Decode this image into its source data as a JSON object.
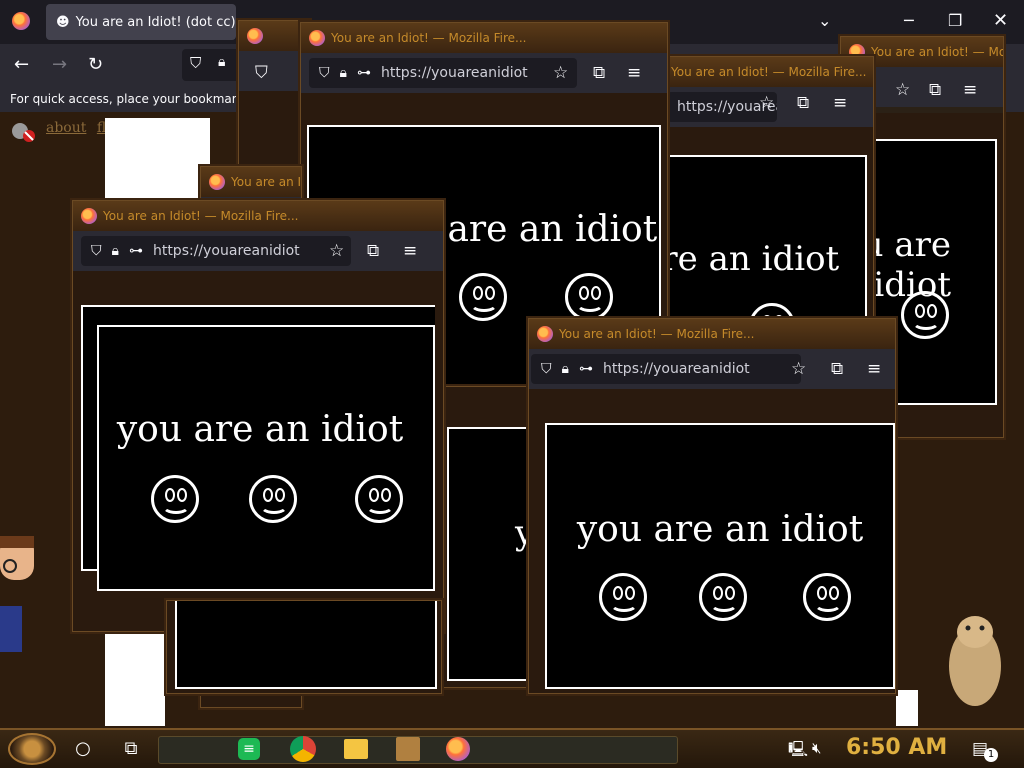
{
  "main": {
    "tab_title": "You are an Idiot! (dot cc)",
    "bookmarks_text": "For quick access, place your bookmarks",
    "link_about": "about",
    "link_flash": "flash"
  },
  "popup_title": "You are an Idiot! — Mozilla Fire...",
  "popup_title_front": "You are an Idiot! — Mozilla Fire...",
  "url_text": "https://youareanidiot",
  "message": "you are an idiot",
  "taskbar": {
    "clock": "6:50 AM",
    "notification_count": "1"
  },
  "icons": [
    "firefox-icon",
    "back-icon",
    "forward-icon",
    "reload-icon",
    "shield-icon",
    "lock-icon",
    "permissions-icon",
    "bookmark-star-icon",
    "extensions-icon",
    "menu-icon",
    "smiley-icon",
    "start-icon",
    "search-circle-icon",
    "task-view-icon",
    "spotify-icon",
    "chrome-icon",
    "file-explorer-icon",
    "network-icon",
    "volume-muted-icon",
    "notification-icon"
  ]
}
